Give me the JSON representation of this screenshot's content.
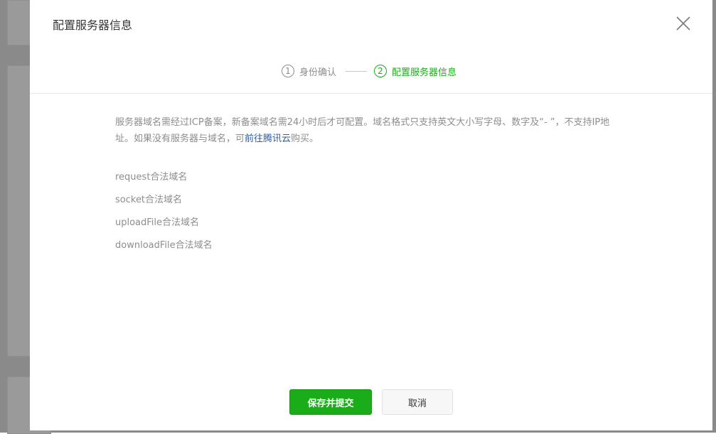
{
  "dialog": {
    "title": "配置服务器信息"
  },
  "steps": [
    {
      "number": "1",
      "label": "身份确认",
      "state": "done"
    },
    {
      "number": "2",
      "label": "配置服务器信息",
      "state": "current"
    }
  ],
  "notice": {
    "text_before_link": "服务器域名需经过ICP备案，新备案域名需24小时后才可配置。域名格式只支持英文大小写字母、数字及“- ”，不支持IP地址。如果没有服务器与域名，可",
    "link_text": "前往腾讯云",
    "text_after_link": "购买。"
  },
  "fields": [
    {
      "label": "request合法域名"
    },
    {
      "label": "socket合法域名"
    },
    {
      "label": "uploadFile合法域名"
    },
    {
      "label": "downloadFile合法域名"
    }
  ],
  "actions": {
    "submit_label": "保存并提交",
    "cancel_label": "取消"
  },
  "colors": {
    "accent": "#1aad19",
    "link": "#2e5b9e",
    "muted_text": "#8d8d8d"
  }
}
